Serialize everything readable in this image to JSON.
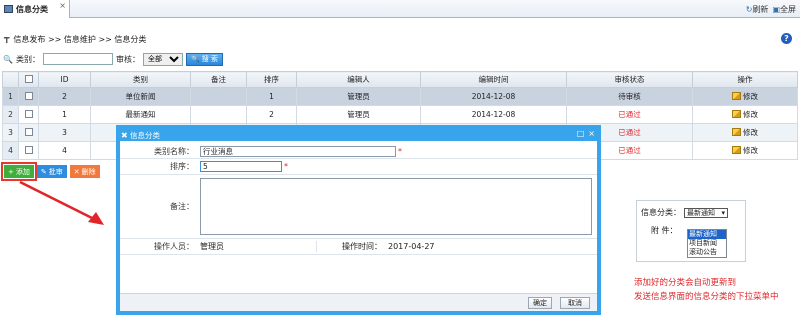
{
  "tab": {
    "title": "信息分类",
    "close": "×"
  },
  "topbar": {
    "refresh": "刷新",
    "fullscreen": "全屏"
  },
  "breadcrumb": "信息发布 >> 信息维护 >> 信息分类",
  "filter": {
    "category_label": "类别：",
    "category_value": "",
    "audit_label": "审核：",
    "audit_selected": "全部",
    "search_button": "搜 索"
  },
  "grid": {
    "columns": [
      "",
      "ID",
      "类别",
      "备注",
      "排序",
      "编辑人",
      "编辑时间",
      "审核状态",
      "操作"
    ],
    "rows": [
      {
        "rn": "1",
        "id": "2",
        "category": "单位新闻",
        "remark": "",
        "order": "1",
        "editor": "管理员",
        "time": "2014-12-08",
        "status": "待审核",
        "action": "修改"
      },
      {
        "rn": "2",
        "id": "1",
        "category": "最新通知",
        "remark": "",
        "order": "2",
        "editor": "管理员",
        "time": "2014-12-08",
        "status": "已通过",
        "action": "修改"
      },
      {
        "rn": "3",
        "id": "3",
        "category": "",
        "remark": "",
        "order": "",
        "editor": "",
        "time": "",
        "status": "已通过",
        "action": "修改"
      },
      {
        "rn": "4",
        "id": "4",
        "category": "",
        "remark": "",
        "order": "",
        "editor": "",
        "time": "",
        "status": "已通过",
        "action": "修改"
      }
    ]
  },
  "actions": {
    "add": "添加",
    "audit": "批审",
    "delete": "删除"
  },
  "dialog": {
    "title": "信息分类",
    "name_label": "类别名称：",
    "name_value": "行业消息",
    "order_label": "排序：",
    "order_value": "5",
    "remark_label": "备注：",
    "operator_label": "操作人员：",
    "operator_value": "管理员",
    "optime_label": "操作时间：",
    "optime_value": "2017-04-27",
    "ok": "确定",
    "cancel": "取消",
    "required_mark": "*"
  },
  "mini": {
    "category_label": "信息分类：",
    "selected": "最新通知",
    "attach_label": "附  件：",
    "options": [
      "最新通知",
      "项目新闻",
      "滚动公告"
    ]
  },
  "note": {
    "line1": "添加好的分类会自动更新到",
    "line2": "发送信息界面的信息分类的下拉菜单中"
  },
  "colors": {
    "accent": "#38a4ec",
    "danger": "#e0262a",
    "add": "#3fae3a"
  }
}
